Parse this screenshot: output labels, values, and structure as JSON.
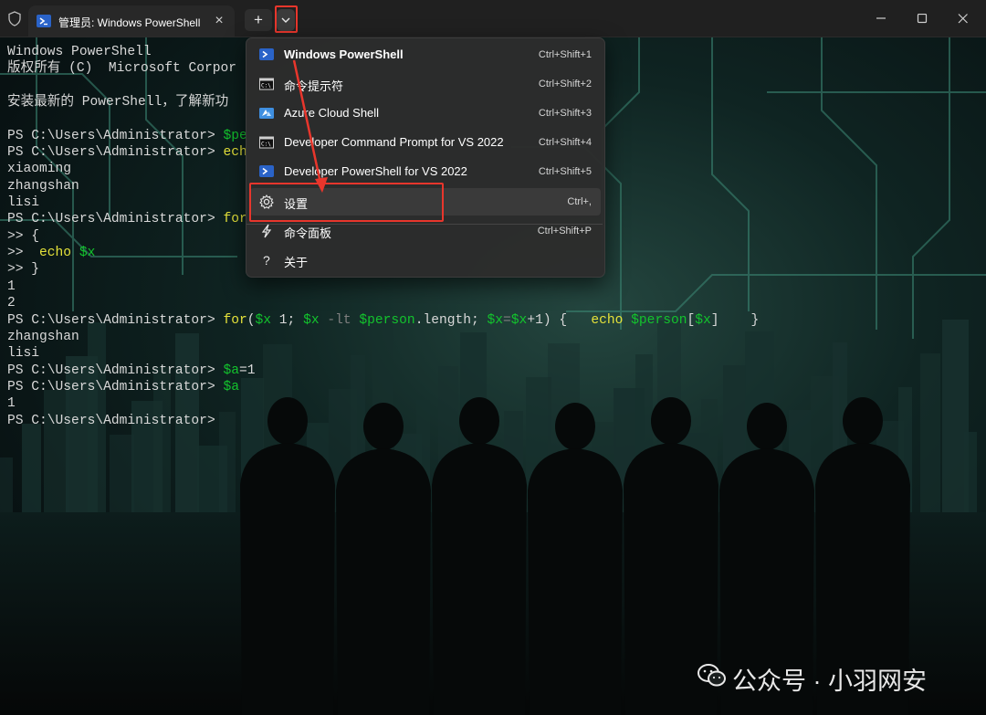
{
  "window": {
    "tab_title": "管理员: Windows PowerShell",
    "close_tab_glyph": "×",
    "new_tab_glyph": "+",
    "controls": [
      "minimize-icon",
      "maximize-icon",
      "close-icon"
    ]
  },
  "terminal": {
    "lines": [
      [
        {
          "t": "Windows PowerShell",
          "c": ""
        }
      ],
      [
        {
          "t": "版权所有 (C)  Microsoft Corpor",
          "c": ""
        }
      ],
      [
        {
          "t": "",
          "c": ""
        }
      ],
      [
        {
          "t": "安装最新的 PowerShell，了解新功",
          "c": ""
        }
      ],
      [
        {
          "t": "",
          "c": ""
        }
      ],
      [
        {
          "t": "PS C:\\Users\\Administrator> ",
          "c": ""
        },
        {
          "t": "$pe",
          "c": "g"
        }
      ],
      [
        {
          "t": "PS C:\\Users\\Administrator> ",
          "c": ""
        },
        {
          "t": "ech",
          "c": "y"
        }
      ],
      [
        {
          "t": "xiaoming",
          "c": ""
        }
      ],
      [
        {
          "t": "zhangshan",
          "c": ""
        }
      ],
      [
        {
          "t": "lisi",
          "c": ""
        }
      ],
      [
        {
          "t": "PS C:\\Users\\Administrator> ",
          "c": ""
        },
        {
          "t": "for",
          "c": "y"
        }
      ],
      [
        {
          "t": ">> {",
          "c": ""
        }
      ],
      [
        {
          "t": ">>  ",
          "c": ""
        },
        {
          "t": "echo ",
          "c": "y"
        },
        {
          "t": "$x",
          "c": "g"
        }
      ],
      [
        {
          "t": ">> }",
          "c": ""
        }
      ],
      [
        {
          "t": "1",
          "c": ""
        }
      ],
      [
        {
          "t": "2",
          "c": ""
        }
      ],
      [
        {
          "t": "PS C:\\Users\\Administrator> ",
          "c": ""
        },
        {
          "t": "for",
          "c": "y"
        },
        {
          "t": "(",
          "c": ""
        },
        {
          "t": "$x",
          "c": "g"
        },
        {
          "t": " 1; ",
          "c": ""
        },
        {
          "t": "$x",
          "c": "g"
        },
        {
          "t": " -lt ",
          "c": "gr"
        },
        {
          "t": "$person",
          "c": "g"
        },
        {
          "t": ".length; ",
          "c": ""
        },
        {
          "t": "$x",
          "c": "g"
        },
        {
          "t": "=",
          "c": "gr"
        },
        {
          "t": "$x",
          "c": "g"
        },
        {
          "t": "+1) {   ",
          "c": ""
        },
        {
          "t": "echo ",
          "c": "y"
        },
        {
          "t": "$person",
          "c": "g"
        },
        {
          "t": "[",
          "c": ""
        },
        {
          "t": "$x",
          "c": "g"
        },
        {
          "t": "]    }",
          "c": ""
        }
      ],
      [
        {
          "t": "zhangshan",
          "c": ""
        }
      ],
      [
        {
          "t": "lisi",
          "c": ""
        }
      ],
      [
        {
          "t": "PS C:\\Users\\Administrator> ",
          "c": ""
        },
        {
          "t": "$a",
          "c": "g"
        },
        {
          "t": "=1",
          "c": ""
        }
      ],
      [
        {
          "t": "PS C:\\Users\\Administrator> ",
          "c": ""
        },
        {
          "t": "$a",
          "c": "g"
        }
      ],
      [
        {
          "t": "1",
          "c": ""
        }
      ],
      [
        {
          "t": "PS C:\\Users\\Administrator> ",
          "c": ""
        }
      ]
    ]
  },
  "menu": {
    "items": [
      {
        "label": "Windows PowerShell",
        "shortcut": "Ctrl+Shift+1",
        "icon": "powershell-icon",
        "bold": true
      },
      {
        "label": "命令提示符",
        "shortcut": "Ctrl+Shift+2",
        "icon": "cmd-icon"
      },
      {
        "label": "Azure Cloud Shell",
        "shortcut": "Ctrl+Shift+3",
        "icon": "azure-icon"
      },
      {
        "label": "Developer Command Prompt for VS 2022",
        "shortcut": "Ctrl+Shift+4",
        "icon": "cmd-icon"
      },
      {
        "label": "Developer PowerShell for VS 2022",
        "shortcut": "Ctrl+Shift+5",
        "icon": "powershell-icon"
      }
    ],
    "actions": [
      {
        "label": "设置",
        "shortcut": "Ctrl+,",
        "icon": "gear-icon"
      },
      {
        "label": "命令面板",
        "shortcut": "Ctrl+Shift+P",
        "icon": "lightning-icon"
      },
      {
        "label": "关于",
        "shortcut": "",
        "icon": "question-icon"
      }
    ]
  },
  "watermark": {
    "text": "公众号 · 小羽网安"
  },
  "colors": {
    "yellow": "#e5e23a",
    "green": "#13c32d",
    "highlight": "#e8362c"
  }
}
